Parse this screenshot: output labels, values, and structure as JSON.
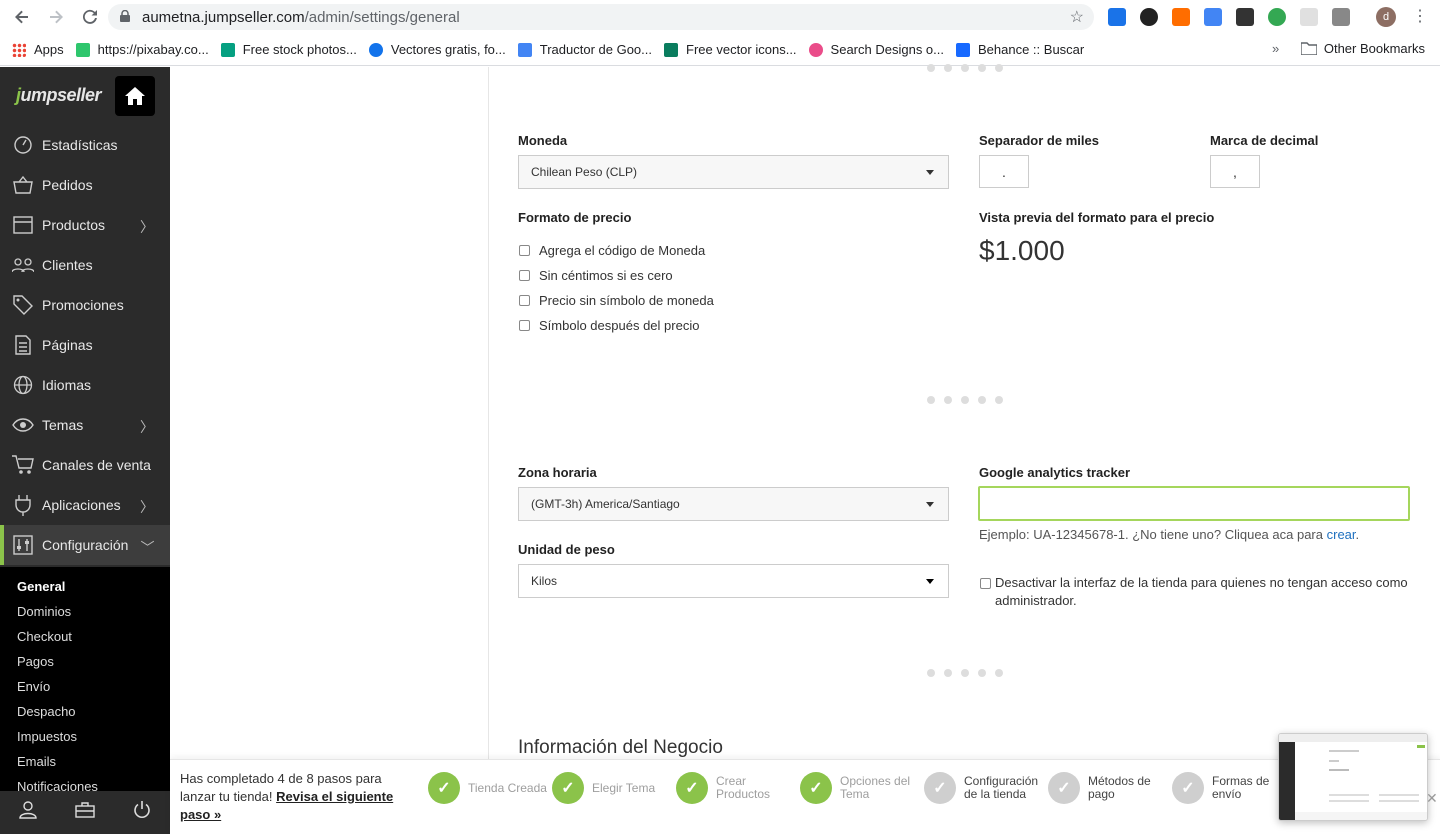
{
  "browser": {
    "url_host": "aumetna.jumpseller.com",
    "url_path": "/admin/settings/general",
    "avatar_letter": "d",
    "extension_badge": "1"
  },
  "bookmarks": {
    "items": [
      {
        "label": "Apps",
        "color": "#4285f4"
      },
      {
        "label": "https://pixabay.co...",
        "color": "#2ec66d"
      },
      {
        "label": "Free stock photos...",
        "color": "#05a081"
      },
      {
        "label": "Vectores gratis, fo...",
        "color": "#1273eb"
      },
      {
        "label": "Traductor de Goo...",
        "color": "#4285f4"
      },
      {
        "label": "Free vector icons...",
        "color": "#0a7d5e"
      },
      {
        "label": "Search Designs o...",
        "color": "#ea4c89"
      },
      {
        "label": "Behance :: Buscar",
        "color": "#1769ff"
      }
    ],
    "other": "Other Bookmarks"
  },
  "sidebar": {
    "logo_first": "j",
    "logo_rest": "umpseller",
    "items": [
      {
        "label": "Estadísticas",
        "icon": "gauge-icon",
        "chevron": false
      },
      {
        "label": "Pedidos",
        "icon": "basket-icon",
        "chevron": false
      },
      {
        "label": "Productos",
        "icon": "box-icon",
        "chevron": true
      },
      {
        "label": "Clientes",
        "icon": "users-icon",
        "chevron": false
      },
      {
        "label": "Promociones",
        "icon": "tag-icon",
        "chevron": false
      },
      {
        "label": "Páginas",
        "icon": "page-icon",
        "chevron": false
      },
      {
        "label": "Idiomas",
        "icon": "globe-icon",
        "chevron": false
      },
      {
        "label": "Temas",
        "icon": "eye-icon",
        "chevron": true
      },
      {
        "label": "Canales de venta",
        "icon": "cart-icon",
        "chevron": false
      },
      {
        "label": "Aplicaciones",
        "icon": "plug-icon",
        "chevron": true
      },
      {
        "label": "Configuración",
        "icon": "sliders-icon",
        "chevron": true
      }
    ],
    "submenu": [
      "General",
      "Dominios",
      "Checkout",
      "Pagos",
      "Envío",
      "Despacho",
      "Impuestos",
      "Emails",
      "Notificaciones"
    ]
  },
  "form": {
    "currency_label": "Moneda",
    "currency_value": "Chilean Peso (CLP)",
    "thousands_label": "Separador de miles",
    "thousands_value": ".",
    "decimal_label": "Marca de decimal",
    "decimal_value": ",",
    "price_format_label": "Formato de precio",
    "price_options": [
      "Agrega el código de Moneda",
      "Sin céntimos si es cero",
      "Precio sin símbolo de moneda",
      "Símbolo después del precio"
    ],
    "preview_label": "Vista previa del formato para el precio",
    "preview_value": "$1.000",
    "timezone_label": "Zona horaria",
    "timezone_value": "(GMT-3h) America/Santiago",
    "ga_label": "Google analytics tracker",
    "ga_value": "",
    "ga_help": "Ejemplo: UA-12345678-1. ¿No tiene uno? Cliquea aca para ",
    "ga_link": "crear",
    "ga_help_end": ".",
    "weight_label": "Unidad de peso",
    "weight_value": "Kilos",
    "disable_storefront": "Desactivar la interfaz de la tienda para quienes no tengan acceso como administrador.",
    "business_title": "Información del Negocio"
  },
  "progress": {
    "text": "Has completado 4 de 8 pasos para lanzar tu tienda! ",
    "link": "Revisa el siguiente paso »",
    "steps": [
      {
        "label": "Tienda Creada",
        "done": true
      },
      {
        "label": "Elegir Tema",
        "done": true
      },
      {
        "label": "Crear Productos",
        "done": true
      },
      {
        "label": "Opciones del Tema",
        "done": true
      },
      {
        "label": "Configuración de la tienda",
        "done": false
      },
      {
        "label": "Métodos de pago",
        "done": false
      },
      {
        "label": "Formas de envío",
        "done": false
      }
    ],
    "check_glyph": "✓"
  },
  "colors": {
    "accent": "#8bc34a",
    "sidebar_bg": "#2b2b2b",
    "link": "#1e70bf"
  }
}
